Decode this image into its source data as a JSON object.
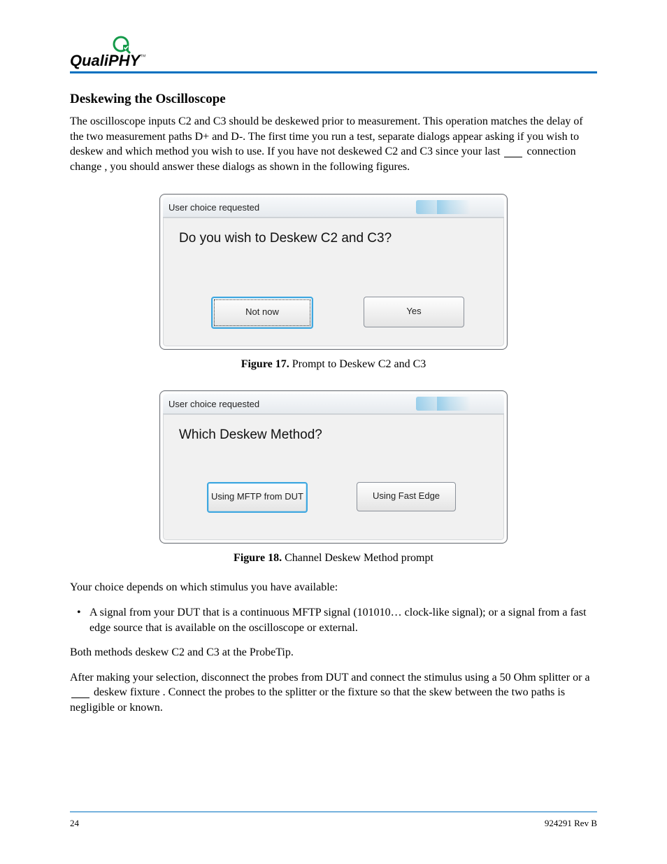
{
  "brand": {
    "name": "QualiPHY",
    "tm": "™"
  },
  "section_title": "Deskewing the Oscilloscope",
  "para1_pre": "The oscilloscope inputs C2 and C3 should be deskewed prior to measurement. This operation matches the delay of the two measurement paths D+ and D-. The first time you run a test, separate dialogs appear asking if you wish to deskew and which method you wish to use. If you have not deskewed C2 and C3 since your last ",
  "para1_link_pre": "connection change",
  "para1_post": ", you should answer these dialogs as shown in the following figures.",
  "dialog1": {
    "title": "User choice requested",
    "question": "Do you wish to Deskew C2 and C3?",
    "btn_left": "Not now",
    "btn_right": "Yes"
  },
  "caption1": {
    "label": "Figure 17.",
    "text": " Prompt to Deskew C2 and C3"
  },
  "dialog2": {
    "title": "User choice requested",
    "question": "Which Deskew Method?",
    "btn_left": "Using MFTP from DUT",
    "btn_right": "Using Fast Edge"
  },
  "caption2": {
    "label": "Figure 18.",
    "text": " Channel Deskew Method prompt"
  },
  "para2_1": "Your choice depends on which stimulus you have available:",
  "bullet": "A signal from your DUT that is a continuous MFTP signal (101010… clock-like signal); or a signal from a fast edge source that is available on the oscilloscope or external.",
  "para3": "Both methods deskew C2 and C3 at the ProbeTip.",
  "para4_pre": "After making your selection, disconnect the probes from DUT and connect the stimulus using a 50 Ohm splitter or a ",
  "para4_link": "deskew fixture",
  "para4_post": ". Connect the probes to the splitter or the fixture so that the skew between the two paths is negligible or known.",
  "footer": {
    "left": "24",
    "right": "924291 Rev B"
  }
}
